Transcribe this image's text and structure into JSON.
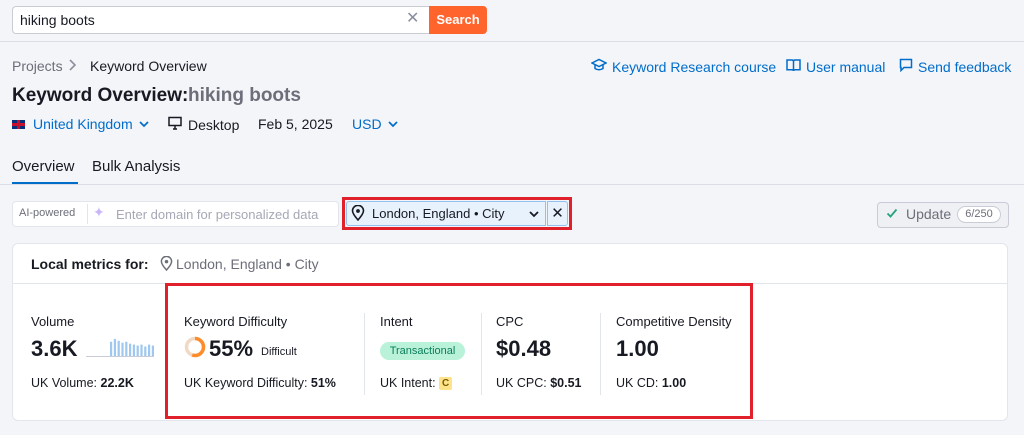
{
  "search": {
    "value": "hiking boots",
    "clear_icon": "close-icon",
    "button_label": "Search"
  },
  "breadcrumb": {
    "items": [
      "Projects",
      "Keyword Overview"
    ],
    "separator_icon": "chevron-right-icon"
  },
  "top_links": [
    {
      "label": "Keyword Research course",
      "icon": "graduation-cap-icon"
    },
    {
      "label": "User manual",
      "icon": "book-icon"
    },
    {
      "label": "Send feedback",
      "icon": "message-icon"
    }
  ],
  "title": {
    "prefix": "Keyword Overview:",
    "query": "hiking boots"
  },
  "meta": {
    "database": "United Kingdom",
    "device": "Desktop",
    "date": "Feb 5, 2025",
    "currency": "USD"
  },
  "tabs": [
    {
      "label": "Overview",
      "active": true
    },
    {
      "label": "Bulk Analysis",
      "active": false
    }
  ],
  "filters": {
    "ai_label": "AI-powered",
    "domain_placeholder": "Enter domain for personalized data",
    "location": "London, England",
    "location_type": "City",
    "location_bullet": "•",
    "update_label": "Update",
    "update_count": "6/250"
  },
  "local_metrics": {
    "label": "Local metrics for:",
    "location": "London, England",
    "location_type": "City",
    "bullet": "•"
  },
  "metrics": {
    "volume": {
      "label": "Volume",
      "value": "3.6K",
      "sub_label": "UK Volume:",
      "sub_value": "22.2K",
      "trend": [
        0.75,
        0.9,
        0.8,
        0.7,
        0.75,
        0.65,
        0.6,
        0.55,
        0.6,
        0.5,
        0.6,
        0.55
      ]
    },
    "kd": {
      "label": "Keyword Difficulty",
      "value": "55%",
      "level": "Difficult",
      "percent": 55,
      "sub_label": "UK Keyword Difficulty:",
      "sub_value": "51%"
    },
    "intent": {
      "label": "Intent",
      "badge": "Transactional",
      "sub_label": "UK Intent:",
      "sub_badge": "C"
    },
    "cpc": {
      "label": "CPC",
      "value": "$0.48",
      "sub_label": "UK CPC:",
      "sub_value": "$0.51"
    },
    "cd": {
      "label": "Competitive Density",
      "value": "1.00",
      "sub_label": "UK CD:",
      "sub_value": "1.00"
    }
  },
  "colors": {
    "accent": "#006dca",
    "search_button": "#ff642d",
    "highlight": "#e0212b",
    "kd_ring": "#ff8c2a",
    "intent_green": "#b9f2d9",
    "trend_bar": "#9ec8ef"
  }
}
